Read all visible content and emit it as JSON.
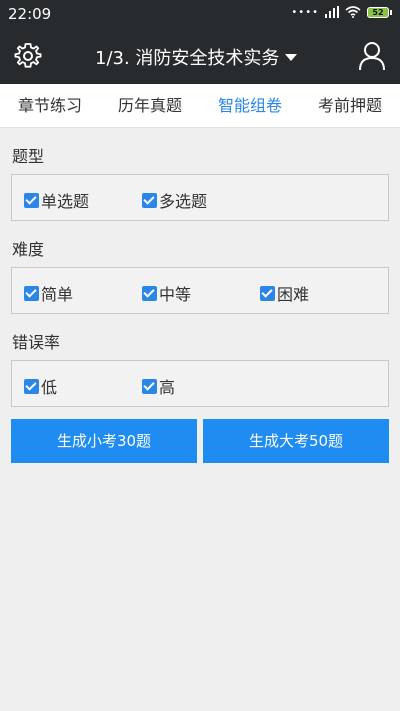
{
  "status": {
    "time": "22:09",
    "battery": "52"
  },
  "appbar": {
    "title": "1/3. 消防安全技术实务"
  },
  "tabs": [
    {
      "label": "章节练习",
      "active": false
    },
    {
      "label": "历年真题",
      "active": false
    },
    {
      "label": "智能组卷",
      "active": true
    },
    {
      "label": "考前押题",
      "active": false
    }
  ],
  "sections": [
    {
      "label": "题型",
      "options": [
        {
          "label": "单选题",
          "checked": true
        },
        {
          "label": "多选题",
          "checked": true
        }
      ]
    },
    {
      "label": "难度",
      "options": [
        {
          "label": "简单",
          "checked": true
        },
        {
          "label": "中等",
          "checked": true
        },
        {
          "label": "困难",
          "checked": true
        }
      ]
    },
    {
      "label": "错误率",
      "options": [
        {
          "label": "低",
          "checked": true
        },
        {
          "label": "高",
          "checked": true
        }
      ]
    }
  ],
  "buttons": {
    "small": "生成小考30题",
    "large": "生成大考50题"
  },
  "colors": {
    "accent": "#2a86e8",
    "bar": "#272b2e",
    "button": "#1e8cf0"
  }
}
